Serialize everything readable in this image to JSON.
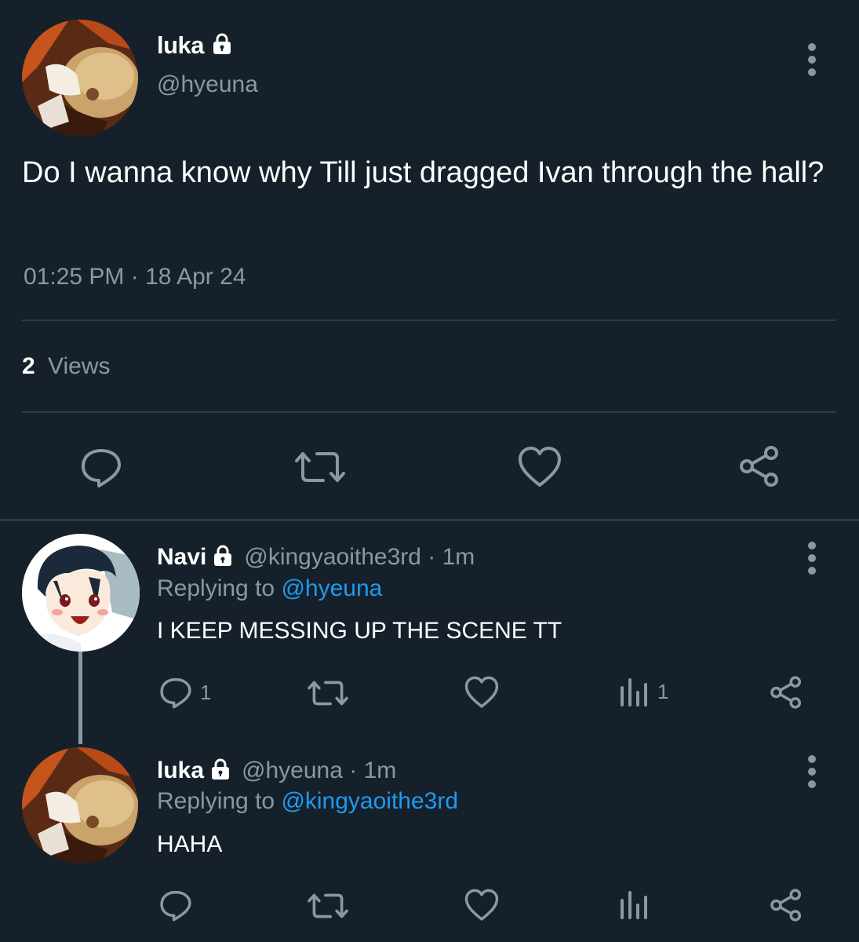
{
  "main_tweet": {
    "display_name": "luka",
    "handle": "@hyeuna",
    "text": "Do I wanna know why Till just dragged Ivan through the hall?",
    "timestamp": "01:25 PM · 18 Apr 24",
    "views_count": "2",
    "views_label": "Views",
    "actions": [
      "reply-icon",
      "retweet-icon",
      "like-icon",
      "share-icon"
    ]
  },
  "replies": [
    {
      "display_name": "Navi",
      "handle_time": "@kingyaoithe3rd · 1m",
      "replying_prefix": "Replying to",
      "replying_to": "@hyeuna",
      "text": "I KEEP MESSING UP THE SCENE TT",
      "reply_count": "1",
      "views_count": "1"
    },
    {
      "display_name": "luka",
      "handle_time": "@hyeuna · 1m",
      "replying_prefix": "Replying to",
      "replying_to": "@kingyaoithe3rd",
      "text": "HAHA",
      "reply_count": "",
      "views_count": ""
    }
  ],
  "colors": {
    "background": "#15202b",
    "muted": "#8899a6",
    "link": "#1d9bf0",
    "divider": "#2f3a45"
  }
}
